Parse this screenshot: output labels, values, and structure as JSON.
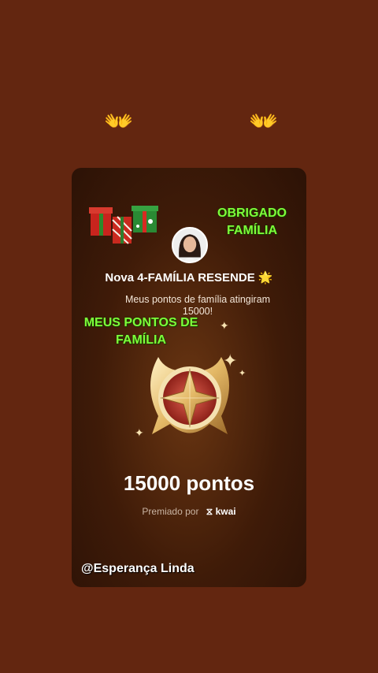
{
  "decor": {
    "hands_left": "👐",
    "hands_right": "👐"
  },
  "card": {
    "thanks_line1": "OBRIGADO",
    "thanks_line2": "FAMÍLIA",
    "family_name": "Nova 4-FAMÍLIA RESENDE 🌟",
    "message": "Meus pontos de família atingiram 15000!",
    "points_overlay_line1": "MEUS PONTOS DE",
    "points_overlay_line2": "FAMÍLIA",
    "points_label": "15000 pontos",
    "awarded_by": "Premiado por",
    "brand": "kwai",
    "handle": "@Esperança Linda"
  },
  "colors": {
    "background": "#632610",
    "overlay_green": "#7dff3a",
    "medal_gold": "#e8c27a",
    "medal_red": "#b4352d"
  },
  "icons": [
    "clapping-hands-icon",
    "gift-boxes-icon",
    "avatar-photo",
    "medal-icon",
    "sparkle-icon",
    "kwai-logo-icon"
  ]
}
